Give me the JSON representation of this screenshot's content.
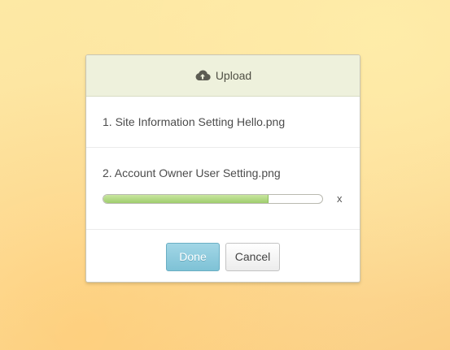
{
  "dialog": {
    "title": "Upload",
    "title_icon": "cloud-upload-icon"
  },
  "files": [
    {
      "label": "1. Site Information Setting Hello.png"
    },
    {
      "label": "2. Account Owner User Setting.png",
      "progress": 0.75,
      "remove_label": "x"
    }
  ],
  "buttons": {
    "done_label": "Done",
    "cancel_label": "Cancel"
  },
  "colors": {
    "header_bg": "#eef1dc",
    "progress_fill": "#a9d47a",
    "done_button": "#8ccbdd"
  }
}
